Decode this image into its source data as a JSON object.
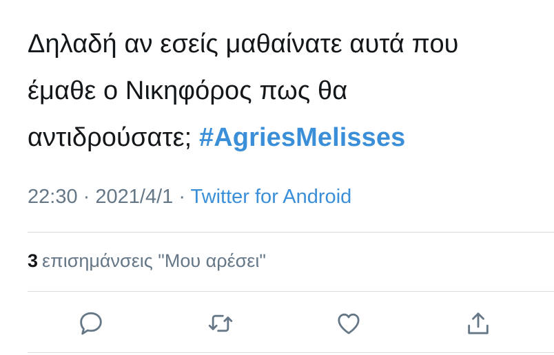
{
  "tweet": {
    "text_lines": [
      "Δηλαδή αν εσείς μαθαίνατε αυτά που",
      "έμαθε ο Νικηφόρος πως θα",
      "αντιδρούσατε;"
    ],
    "hashtag": "#AgriesMelisses",
    "time": "22:30",
    "separator": "·",
    "date": "2021/4/1",
    "source": "Twitter for Android",
    "likes_count": "3",
    "likes_label": "επισημάνσεις \"Μου αρέσει\""
  },
  "actions": {
    "reply_icon": "reply-icon",
    "retweet_icon": "retweet-icon",
    "like_icon": "heart-icon",
    "share_icon": "share-icon"
  },
  "colors": {
    "text": "#14171a",
    "muted": "#657786",
    "link": "#3a8fd8",
    "divider": "#d6dbdf"
  }
}
